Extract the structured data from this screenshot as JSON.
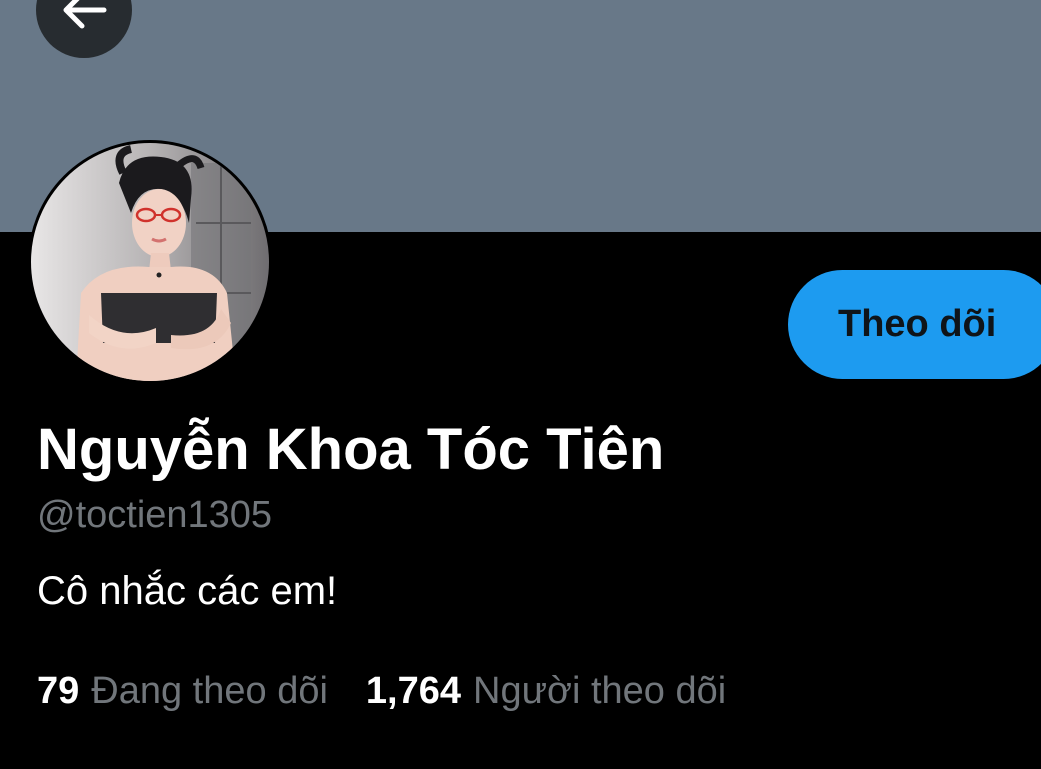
{
  "colors": {
    "background": "#000000",
    "banner": "#687888",
    "accent": "#1D9BF0",
    "button_text": "#0F1419",
    "primary_text": "#FFFFFF",
    "secondary_text": "#71767B",
    "back_button_bg": "#272C30"
  },
  "header": {
    "back_icon": "arrow-left-icon"
  },
  "profile": {
    "avatar_icon": "profile-photo",
    "follow_button_label": "Theo dõi",
    "display_name": "Nguyễn Khoa Tóc Tiên",
    "handle": "@toctien1305",
    "bio": "Cô nhắc các em!",
    "stats": {
      "following_count": "79",
      "following_label": "Đang theo dõi",
      "followers_count": "1,764",
      "followers_label": "Người theo dõi"
    }
  }
}
